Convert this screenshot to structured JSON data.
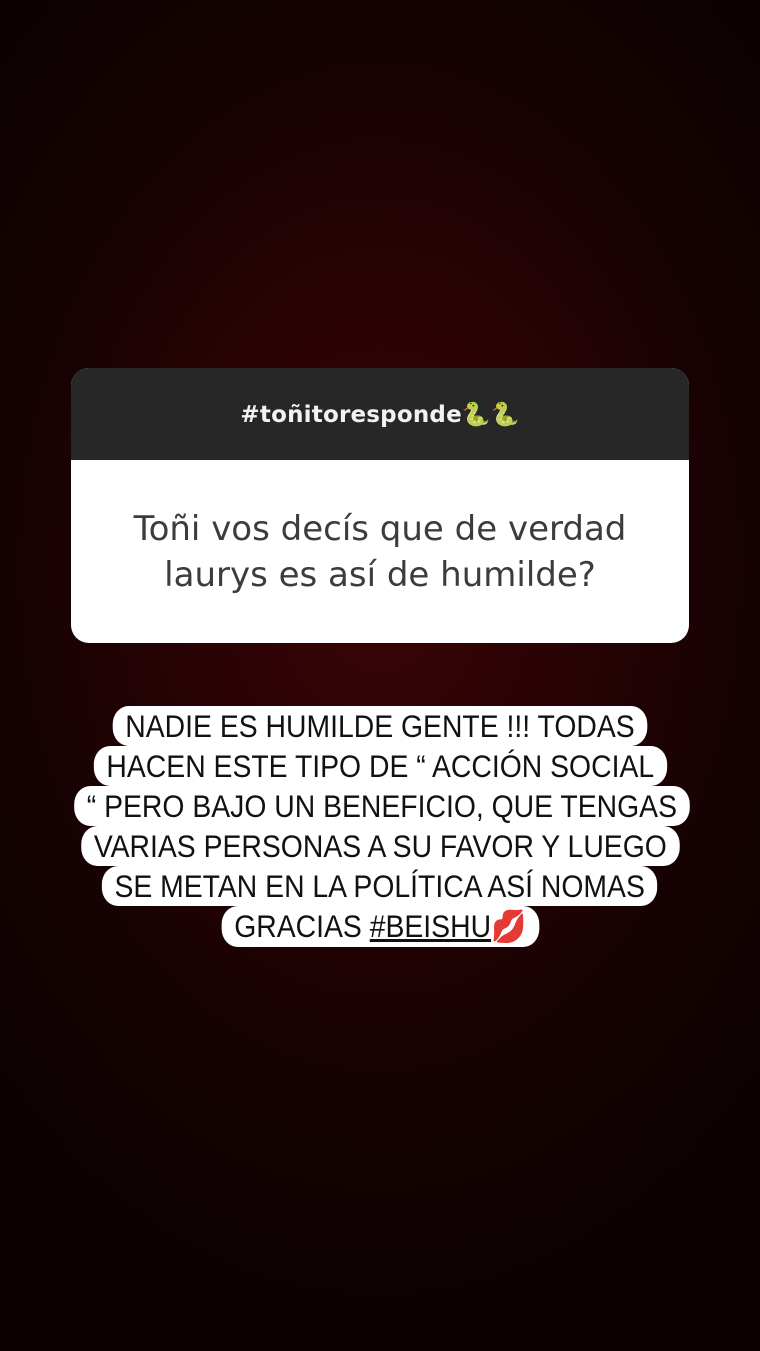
{
  "question_sticker": {
    "header": "#toñitoresponde🐍🐍",
    "question": "Toñi vos decís que de verdad laurys es así de humilde?"
  },
  "answer_text": {
    "lines": [
      "NADIE ES HUMILDE GENTE !!! TODAS",
      "HACEN ESTE TIPO DE “ ACCIÓN SOCIAL",
      "“ PERO BAJO UN BENEFICIO, QUE TENGAS",
      "VARIAS PERSONAS A SU FAVOR Y LUEGO",
      "SE METAN EN LA POLÍTICA ASÍ NOMAS"
    ],
    "last_line_prefix": "GRACIAS ",
    "hashtag": "#BEISHU",
    "emoji": "💋"
  },
  "colors": {
    "background": "#2a0305",
    "sticker_header": "#272727",
    "sticker_body": "#ffffff",
    "text_highlight": "#ffffff"
  }
}
